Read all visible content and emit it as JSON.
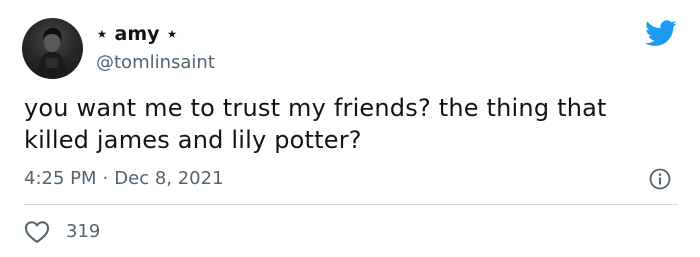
{
  "author": {
    "display_name": "⋆ amy ⋆",
    "handle": "@tomlinsaint"
  },
  "tweet": {
    "text": "you want me to trust my friends? the thing that killed james and lily potter?",
    "time": "4:25 PM",
    "separator": "·",
    "date": "Dec 8, 2021"
  },
  "engagement": {
    "like_count": "319"
  },
  "icons": {
    "brand": "twitter-bird-icon",
    "info": "info-icon",
    "like": "heart-icon"
  },
  "colors": {
    "brand": "#1d9bf0",
    "secondary_text": "#536471",
    "divider": "#cfd9de"
  }
}
